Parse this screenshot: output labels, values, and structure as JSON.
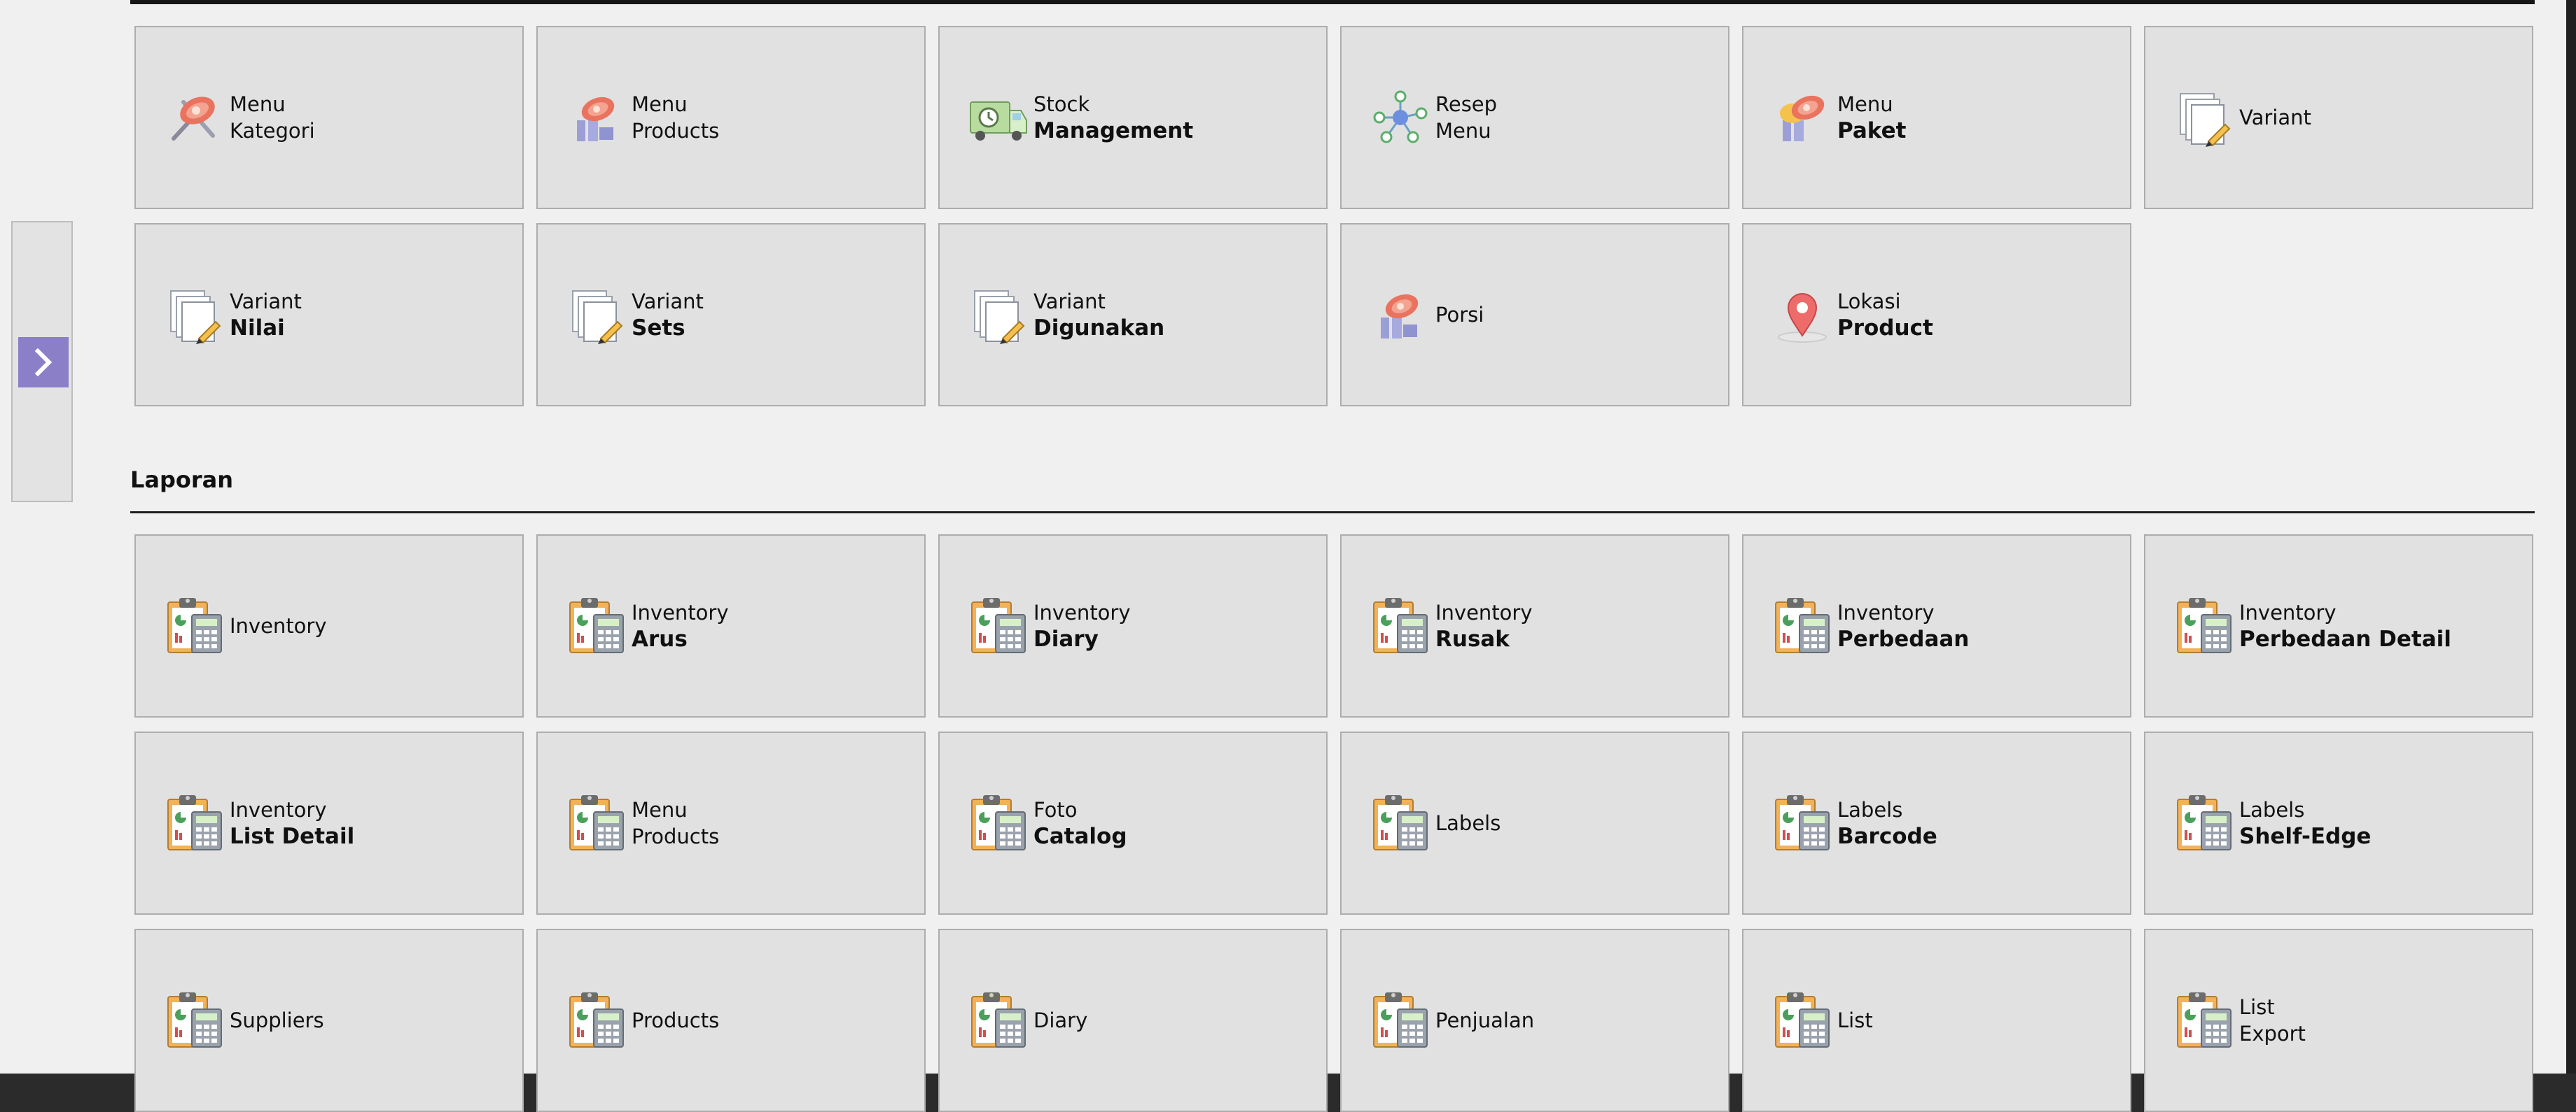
{
  "master_tiles": [
    {
      "line1": "Menu",
      "line2": "Kategori",
      "bold": false,
      "icon": "food-icon"
    },
    {
      "line1": "Menu",
      "line2": "Products",
      "bold": false,
      "icon": "menu-products-icon"
    },
    {
      "line1": "Stock",
      "line2": "Management",
      "bold": true,
      "icon": "truck-icon"
    },
    {
      "line1": "Resep",
      "line2": "Menu",
      "bold": false,
      "icon": "network-icon"
    },
    {
      "line1": "Menu",
      "line2": "Paket",
      "bold": true,
      "icon": "food-package-icon"
    },
    {
      "line1": "Variant",
      "line2": "",
      "bold": false,
      "icon": "documents-icon"
    },
    {
      "line1": "Variant",
      "line2": "Nilai",
      "bold": true,
      "icon": "documents-icon"
    },
    {
      "line1": "Variant",
      "line2": "Sets",
      "bold": true,
      "icon": "documents-icon"
    },
    {
      "line1": "Variant",
      "line2": "Digunakan",
      "bold": true,
      "icon": "documents-icon"
    },
    {
      "line1": "Porsi",
      "line2": "",
      "bold": false,
      "icon": "menu-products-icon"
    },
    {
      "line1": "Lokasi",
      "line2": "Product",
      "bold": true,
      "icon": "location-pin-icon"
    }
  ],
  "laporan": {
    "title": "Laporan",
    "tiles": [
      {
        "line1": "Inventory",
        "line2": "",
        "bold": false,
        "icon": "clipboard-report-icon"
      },
      {
        "line1": "Inventory",
        "line2": "Arus",
        "bold": true,
        "icon": "clipboard-report-icon"
      },
      {
        "line1": "Inventory",
        "line2": "Diary",
        "bold": true,
        "icon": "clipboard-report-icon"
      },
      {
        "line1": "Inventory",
        "line2": "Rusak",
        "bold": true,
        "icon": "clipboard-report-icon"
      },
      {
        "line1": "Inventory",
        "line2": "Perbedaan",
        "bold": true,
        "icon": "clipboard-report-icon"
      },
      {
        "line1": "Inventory",
        "line2": "Perbedaan Detail",
        "bold": true,
        "icon": "clipboard-report-icon"
      },
      {
        "line1": "Inventory",
        "line2": "List Detail",
        "bold": true,
        "icon": "clipboard-report-icon"
      },
      {
        "line1": "Menu",
        "line2": "Products",
        "bold": false,
        "icon": "clipboard-report-icon"
      },
      {
        "line1": "Foto",
        "line2": "Catalog",
        "bold": true,
        "icon": "clipboard-report-icon"
      },
      {
        "line1": "Labels",
        "line2": "",
        "bold": false,
        "icon": "clipboard-report-icon"
      },
      {
        "line1": "Labels",
        "line2": "Barcode",
        "bold": true,
        "icon": "clipboard-report-icon"
      },
      {
        "line1": "Labels",
        "line2": "Shelf-Edge",
        "bold": true,
        "icon": "clipboard-report-icon"
      },
      {
        "line1": "Suppliers",
        "line2": "",
        "bold": false,
        "icon": "clipboard-report-icon"
      },
      {
        "line1": "Products",
        "line2": "",
        "bold": false,
        "icon": "clipboard-report-icon"
      },
      {
        "line1": "Diary",
        "line2": "",
        "bold": false,
        "icon": "clipboard-report-icon"
      },
      {
        "line1": "Penjualan",
        "line2": "",
        "bold": false,
        "icon": "clipboard-report-icon"
      },
      {
        "line1": "List",
        "line2": "",
        "bold": false,
        "icon": "clipboard-report-icon"
      },
      {
        "line1": "List",
        "line2": "Export",
        "bold": false,
        "icon": "clipboard-report-icon"
      }
    ]
  },
  "sidebar": {
    "toggle_icon": "chevron-right-icon"
  },
  "colors": {
    "background": "#f0f0f0",
    "tile": "#e1e1e1",
    "tile_border": "#adadad",
    "toggle_accent": "#8b7fc8"
  }
}
